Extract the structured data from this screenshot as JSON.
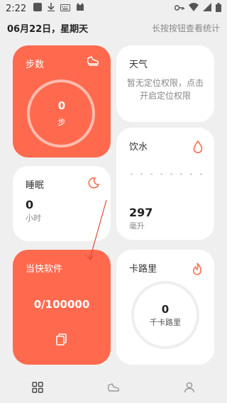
{
  "status_bar": {
    "time": "2:22",
    "icons": [
      "app-notification-icon",
      "download-icon",
      "keyboard-icon",
      "cat-icon",
      "key-icon",
      "wifi-icon",
      "signal-icon",
      "battery-icon"
    ]
  },
  "header": {
    "date": "06月22日，星期天",
    "hint": "长按按钮查看统计"
  },
  "cards": {
    "steps": {
      "title": "步数",
      "value": "0",
      "unit": "步",
      "icon": "shoe-icon",
      "color": "#ff6a4e"
    },
    "weather": {
      "title": "天气",
      "message": "暂无定位权限，点击开启定位权限"
    },
    "water": {
      "title": "饮水",
      "value": "297",
      "unit": "毫升",
      "icon": "water-drop-icon"
    },
    "sleep": {
      "title": "睡眠",
      "value": "0",
      "unit": "小时",
      "icon": "moon-icon"
    },
    "app": {
      "title": "当快软件",
      "value": "0/100000",
      "icon": "copy-icon",
      "color": "#ff6a4e"
    },
    "calories": {
      "title": "卡路里",
      "value": "0",
      "unit": "千卡路里",
      "icon": "flame-icon"
    }
  },
  "bottom_nav": {
    "items": [
      "grid-icon",
      "shoe-icon",
      "person-icon"
    ],
    "active_index": 0
  },
  "colors": {
    "accent": "#ff6a4e",
    "background": "#efefef"
  }
}
